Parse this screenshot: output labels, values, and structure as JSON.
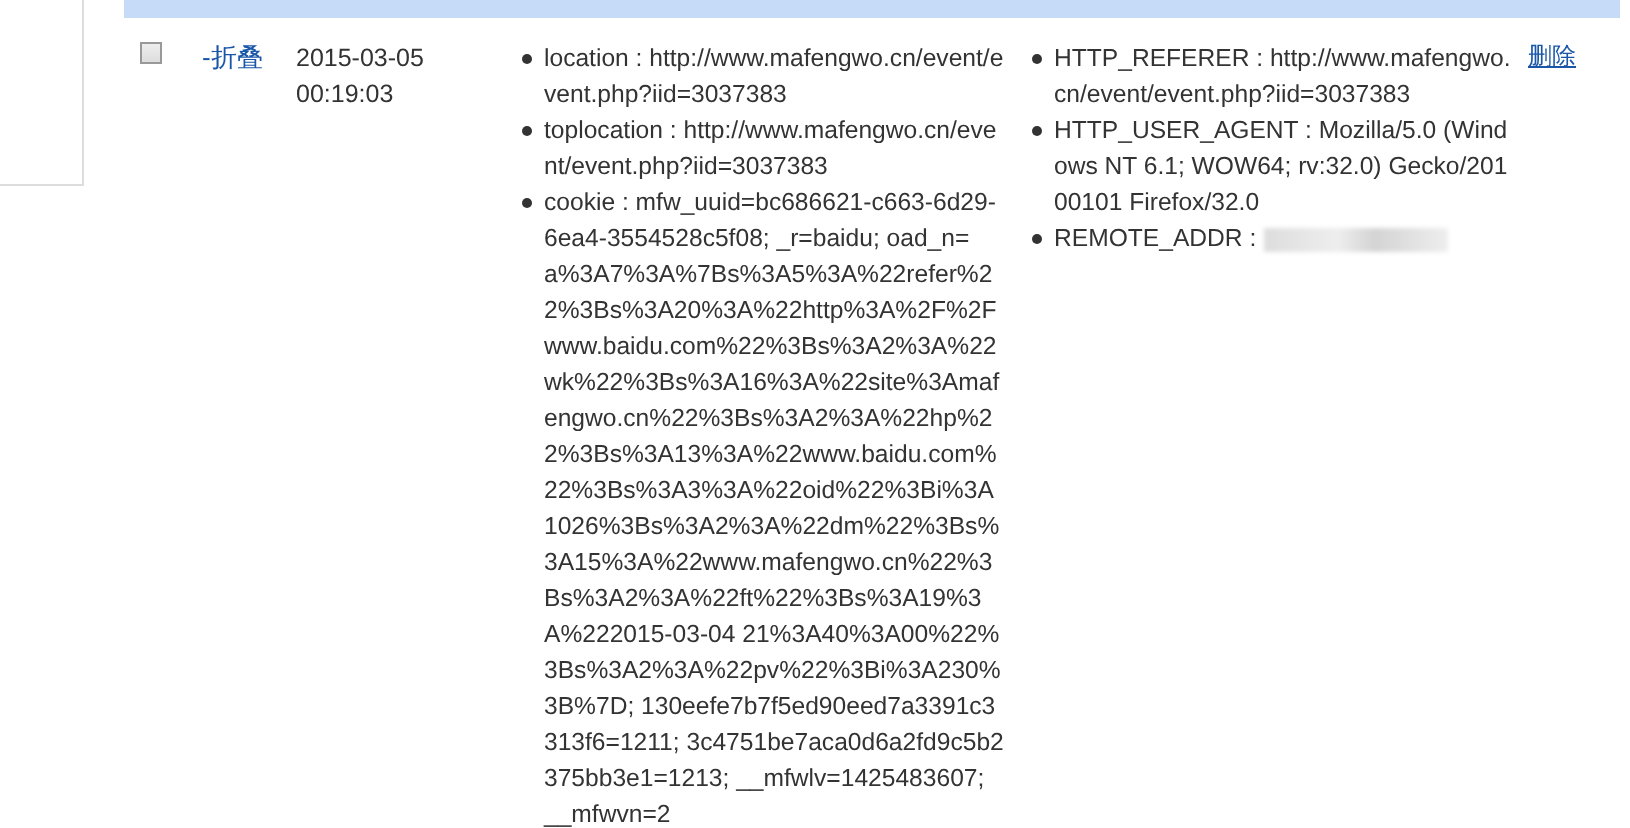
{
  "table": {
    "rows": [
      {
        "checked": false,
        "toggle_link": "-折叠",
        "time": [
          "2015-03-05",
          "00:19:03"
        ],
        "params": [
          "location : http://www.mafengwo.cn/event/event.php?iid=3037383",
          "toplocation : http://www.mafengwo.cn/event/event.php?iid=3037383",
          "cookie : mfw_uuid=bc686621-c663-6d29-6ea4-3554528c5f08; _r=baidu; oad_n=a%3A7%3A%7Bs%3A5%3A%22refer%22%3Bs%3A20%3A%22http%3A%2F%2Fwww.baidu.com%22%3Bs%3A2%3A%22wk%22%3Bs%3A16%3A%22site%3Amafengwo.cn%22%3Bs%3A2%3A%22hp%22%3Bs%3A13%3A%22www.baidu.com%22%3Bs%3A3%3A%22oid%22%3Bi%3A1026%3Bs%3A2%3A%22dm%22%3Bs%3A15%3A%22www.mafengwo.cn%22%3Bs%3A2%3A%22ft%22%3Bs%3A19%3A%222015-03-04 21%3A40%3A00%22%3Bs%3A2%3A%22pv%22%3Bi%3A230%3B%7D; 130eefe7b7f5ed90eed7a3391c3313f6=1211; 3c4751be7aca0d6a2fd9c5b2375bb3e1=1213; __mfwlv=1425483607; __mfwvn=2"
        ],
        "server": [
          {
            "text": "HTTP_REFERER : http://www.mafengwo.cn/event/event.php?iid=3037383",
            "redacted": false
          },
          {
            "text": "HTTP_USER_AGENT : Mozilla/5.0 (Windows NT 6.1; WOW64; rv:32.0) Gecko/20100101 Firefox/32.0",
            "redacted": false
          },
          {
            "text": "REMOTE_ADDR :",
            "redacted": true
          }
        ],
        "delete_link": "删除"
      }
    ]
  }
}
